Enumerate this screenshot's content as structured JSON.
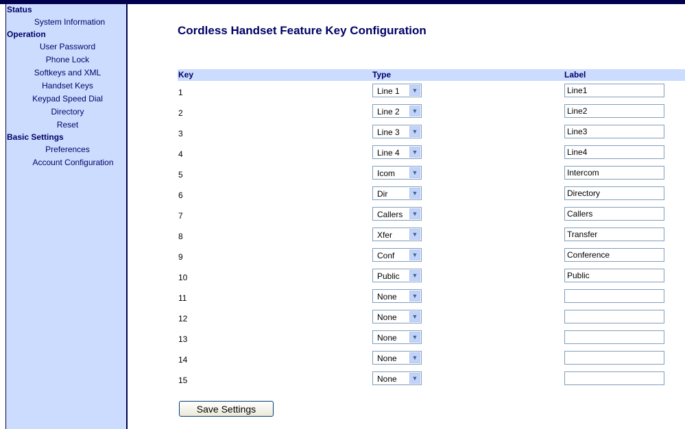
{
  "sidebar": {
    "status": {
      "title": "Status",
      "items": [
        "System Information"
      ]
    },
    "operation": {
      "title": "Operation",
      "items": [
        "User Password",
        "Phone Lock",
        "Softkeys and XML",
        "Handset Keys",
        "Keypad Speed Dial",
        "Directory",
        "Reset"
      ]
    },
    "basic": {
      "title": "Basic Settings",
      "items": [
        "Preferences",
        "Account Configuration"
      ]
    }
  },
  "page": {
    "title": "Cordless Handset Feature Key Configuration"
  },
  "table": {
    "headers": {
      "key": "Key",
      "type": "Type",
      "label": "Label"
    },
    "rows": [
      {
        "key": "1",
        "type": "Line 1",
        "label": "Line1"
      },
      {
        "key": "2",
        "type": "Line 2",
        "label": "Line2"
      },
      {
        "key": "3",
        "type": "Line 3",
        "label": "Line3"
      },
      {
        "key": "4",
        "type": "Line 4",
        "label": "Line4"
      },
      {
        "key": "5",
        "type": "Icom",
        "label": "Intercom"
      },
      {
        "key": "6",
        "type": "Dir",
        "label": "Directory"
      },
      {
        "key": "7",
        "type": "Callers",
        "label": "Callers"
      },
      {
        "key": "8",
        "type": "Xfer",
        "label": "Transfer"
      },
      {
        "key": "9",
        "type": "Conf",
        "label": "Conference"
      },
      {
        "key": "10",
        "type": "Public",
        "label": "Public"
      },
      {
        "key": "11",
        "type": "None",
        "label": ""
      },
      {
        "key": "12",
        "type": "None",
        "label": ""
      },
      {
        "key": "13",
        "type": "None",
        "label": ""
      },
      {
        "key": "14",
        "type": "None",
        "label": ""
      },
      {
        "key": "15",
        "type": "None",
        "label": ""
      }
    ]
  },
  "actions": {
    "save_label": "Save Settings"
  },
  "icons": {
    "dropdown": "chevron-down-icon"
  },
  "colors": {
    "nav_bg": "#ccdcff",
    "nav_text": "#000066",
    "frame": "#00004d"
  }
}
